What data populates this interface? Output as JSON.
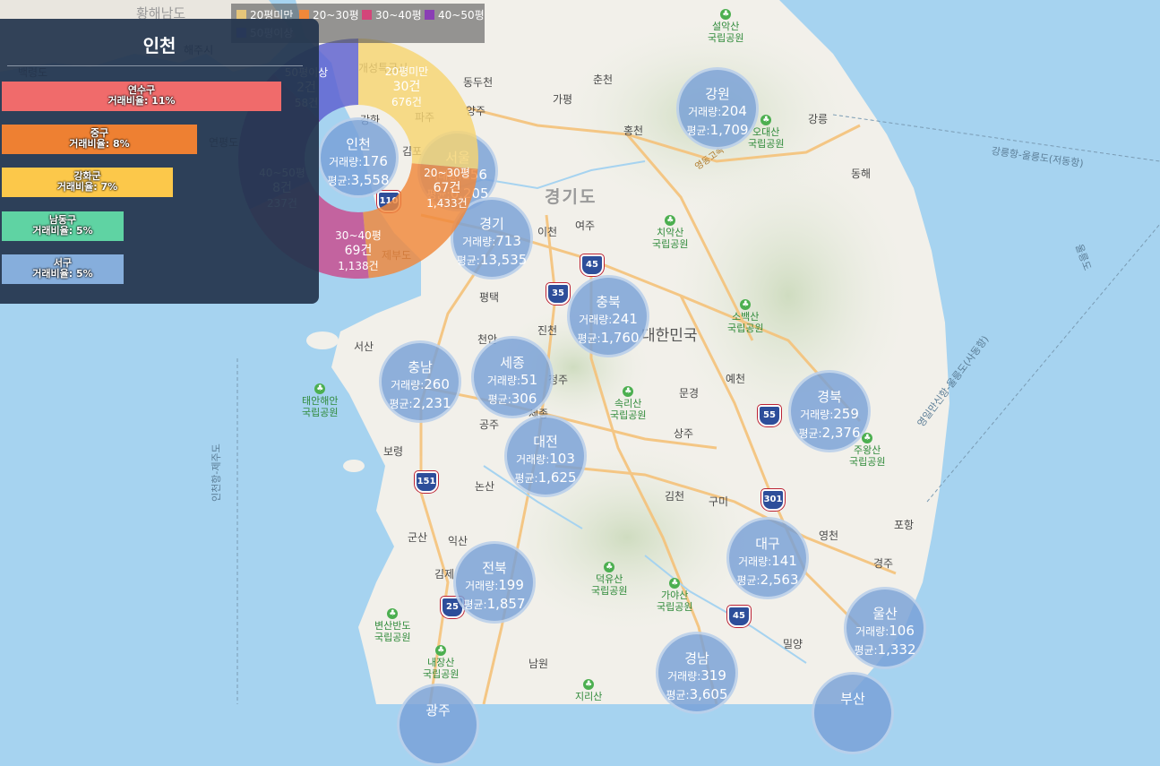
{
  "legend": [
    {
      "label": "20평미만",
      "color": "#e6c67a"
    },
    {
      "label": "20~30평",
      "color": "#f0883a"
    },
    {
      "label": "30~40평",
      "color": "#d3457a"
    },
    {
      "label": "40~50평",
      "color": "#8a3fb5"
    },
    {
      "label": "50평이상",
      "color": "#5f5fd8"
    }
  ],
  "panel": {
    "title": "인천",
    "bars": [
      {
        "name": "연수구",
        "ratio_label": "거래비율: 11%",
        "ratio": 11,
        "color": "#f06b6b"
      },
      {
        "name": "중구",
        "ratio_label": "거래비율: 8%",
        "ratio": 8,
        "color": "#ee8032"
      },
      {
        "name": "강화군",
        "ratio_label": "거래비율: 7%",
        "ratio": 7,
        "color": "#fcc84a"
      },
      {
        "name": "남동구",
        "ratio_label": "거래비율: 5%",
        "ratio": 5,
        "color": "#5fd3a3"
      },
      {
        "name": "서구",
        "ratio_label": "거래비율: 5%",
        "ratio": 5,
        "color": "#86aedc"
      }
    ]
  },
  "donut": {
    "segments": [
      {
        "label": "20평미만",
        "count_label": "30건",
        "avg_label": "676건",
        "color": "#f7d471"
      },
      {
        "label": "20~30평",
        "count_label": "67건",
        "avg_label": "1,433건",
        "color": "#f0883a"
      },
      {
        "label": "30~40평",
        "count_label": "69건",
        "avg_label": "1,138건",
        "color": "#c94a8c"
      },
      {
        "label": "40~50평",
        "count_label": "8건",
        "avg_label": "237건",
        "color": "#7a3aa8"
      },
      {
        "label": "50평이상",
        "count_label": "2건",
        "avg_label": "58건",
        "color": "#5d5fd0"
      }
    ]
  },
  "bubbles": [
    {
      "name": "인천",
      "vol_label": "거래량:",
      "vol": "176",
      "avg_label": "평균:",
      "avg": "3,558"
    },
    {
      "name": "서울",
      "vol_label": "거래량:",
      "vol": "156",
      "avg_label": "평균:",
      "avg": "6,205"
    },
    {
      "name": "강원",
      "vol_label": "거래량:",
      "vol": "204",
      "avg_label": "평균:",
      "avg": "1,709"
    },
    {
      "name": "경기",
      "vol_label": "거래량:",
      "vol": "713",
      "avg_label": "평균:",
      "avg": "13,535"
    },
    {
      "name": "충북",
      "vol_label": "거래량:",
      "vol": "241",
      "avg_label": "평균:",
      "avg": "1,760"
    },
    {
      "name": "충남",
      "vol_label": "거래량:",
      "vol": "260",
      "avg_label": "평균:",
      "avg": "2,231"
    },
    {
      "name": "세종",
      "vol_label": "거래량:",
      "vol": "51",
      "avg_label": "평균:",
      "avg": "306"
    },
    {
      "name": "대전",
      "vol_label": "거래량:",
      "vol": "103",
      "avg_label": "평균:",
      "avg": "1,625"
    },
    {
      "name": "경북",
      "vol_label": "거래량:",
      "vol": "259",
      "avg_label": "평균:",
      "avg": "2,376"
    },
    {
      "name": "전북",
      "vol_label": "거래량:",
      "vol": "199",
      "avg_label": "평균:",
      "avg": "1,857"
    },
    {
      "name": "대구",
      "vol_label": "거래량:",
      "vol": "141",
      "avg_label": "평균:",
      "avg": "2,563"
    },
    {
      "name": "울산",
      "vol_label": "거래량:",
      "vol": "106",
      "avg_label": "평균:",
      "avg": "1,332"
    },
    {
      "name": "경남",
      "vol_label": "거래량:",
      "vol": "319",
      "avg_label": "평균:",
      "avg": "3,605"
    },
    {
      "name": "부산",
      "vol_label": "",
      "vol": "",
      "avg_label": "",
      "avg": ""
    },
    {
      "name": "광주",
      "vol_label": "",
      "vol": "",
      "avg_label": "",
      "avg": ""
    }
  ],
  "places": [
    "황해남도",
    "해주시",
    "개성특급시",
    "동두천",
    "춘천",
    "가평",
    "양주",
    "홍천",
    "강릉",
    "동해",
    "파주",
    "강화",
    "김포",
    "경기도",
    "이천",
    "여주",
    "평택",
    "천안",
    "진천",
    "청주",
    "세종",
    "공주",
    "서산",
    "보령",
    "논산",
    "익산",
    "군산",
    "김제",
    "문경",
    "예천",
    "상주",
    "김천",
    "구미",
    "영천",
    "포항",
    "경주",
    "밀양",
    "남원",
    "제부도",
    "대한민국",
    "백령도",
    "연평도"
  ],
  "parks": [
    "설악산 국립공원",
    "오대산 국립공원",
    "치악산 국립공원",
    "소백산 국립공원",
    "속리산 국립공원",
    "태안해안 국립공원",
    "주왕산 국립공원",
    "덕유산 국립공원",
    "가야산 국립공원",
    "변산반도 국립공원",
    "내장산 국립공원",
    "지리산"
  ],
  "roads": [
    "35",
    "45",
    "110",
    "55",
    "151",
    "301",
    "25",
    "45"
  ],
  "sea_routes": [
    "강릉항-울릉도(저동항)",
    "영일만신항-울릉도(사동항)",
    "울릉도",
    "인천항-제주도"
  ],
  "road_label": "영동고속"
}
